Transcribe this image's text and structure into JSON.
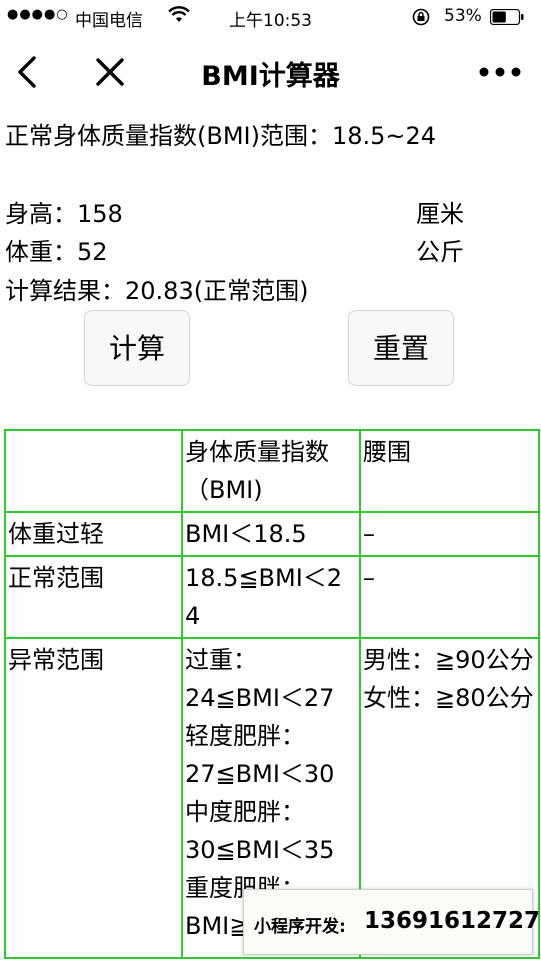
{
  "status_bar": {
    "signal": "●●●●○",
    "carrier": "中国电信",
    "time": "上午10:53",
    "battery_percent": "53%",
    "battery_level": 0.53
  },
  "nav": {
    "title": "BMI计算器",
    "back_icon": "chevron-left-icon",
    "close_icon": "close-icon",
    "more_icon": "more-dots-icon"
  },
  "form": {
    "normal_range_text": "正常身体质量指数(BMI)范围：18.5~24",
    "height_label": "身高：",
    "height_value": "158",
    "height_unit": "厘米",
    "weight_label": "体重：",
    "weight_value": "52",
    "weight_unit": "公斤",
    "result_label": "计算结果：",
    "result_value": "20.83(正常范围)"
  },
  "buttons": {
    "calculate": "计算",
    "reset": "重置"
  },
  "table": {
    "header": [
      "",
      "身体质量指数（BMI)",
      "腰围"
    ],
    "rows": [
      {
        "label": "体重过轻",
        "bmi": [
          "BMI＜18.5"
        ],
        "waist": [
          "–"
        ]
      },
      {
        "label": "正常范围",
        "bmi": [
          "18.5≦BMI＜24"
        ],
        "waist": [
          "–"
        ]
      },
      {
        "label": "异常范围",
        "bmi": [
          "过重：",
          "24≦BMI＜27",
          "轻度肥胖：",
          "27≦BMI＜30",
          "中度肥胖：",
          "30≦BMI＜35",
          "重度肥胖：",
          "BMI≧35"
        ],
        "waist": [
          "男性：≧90公分",
          "女性：≧80公分"
        ]
      }
    ]
  },
  "badge": {
    "label": "小程序开发:",
    "phone": "13691612727"
  },
  "colors": {
    "table_border": "#32c832",
    "button_bg": "#f8f8f8"
  }
}
